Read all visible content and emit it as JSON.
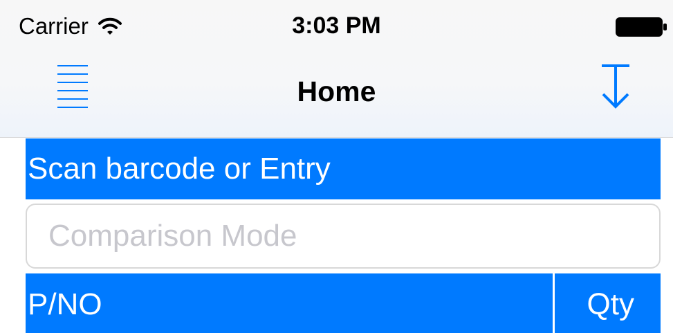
{
  "status_bar": {
    "carrier": "Carrier",
    "time": "3:03 PM",
    "icons": [
      "wifi-icon",
      "battery-icon"
    ]
  },
  "nav_bar": {
    "title": "Home",
    "left_icon": "menu-icon",
    "right_icon": "download-icon"
  },
  "scan_section": {
    "header": "Scan barcode or Entry",
    "comparison_input": {
      "value": "",
      "placeholder": "Comparison Mode"
    }
  },
  "table": {
    "columns": [
      "P/NO",
      "Qty"
    ]
  },
  "colors": {
    "accent": "#007aff",
    "nav_background": "#f7f7f7",
    "placeholder": "#c7c7cd",
    "input_border": "#d8d8d8"
  }
}
